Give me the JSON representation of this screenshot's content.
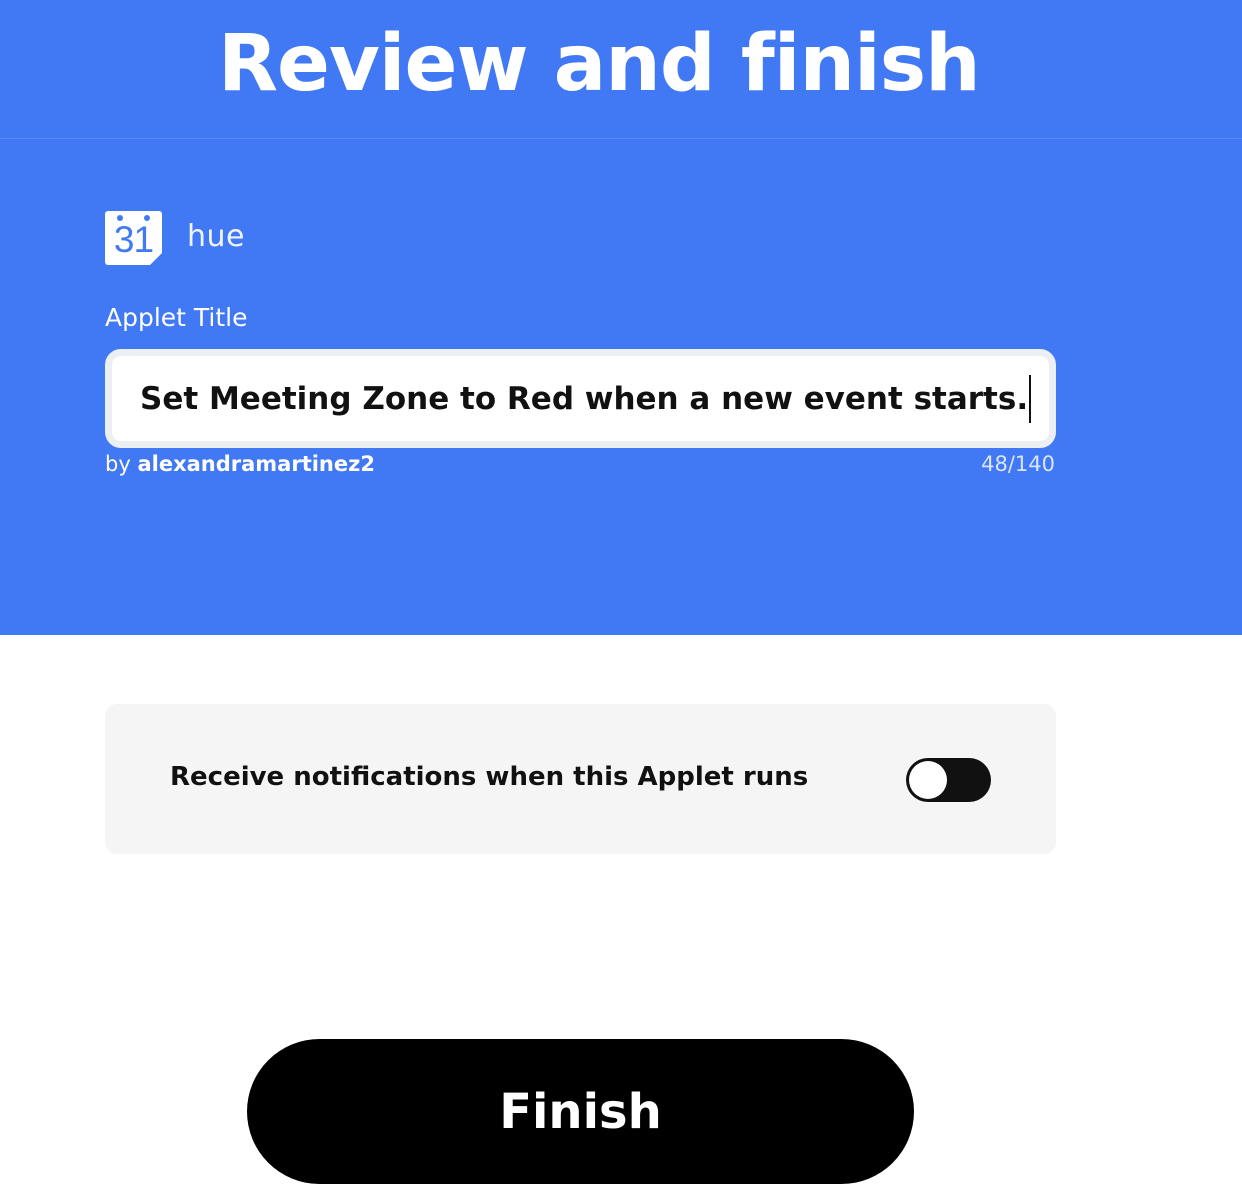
{
  "header": {
    "title": "Review and finish"
  },
  "services": {
    "trigger_icon": "google-calendar-icon",
    "trigger_icon_text": "31",
    "action_icon": "hue-logo",
    "action_logo_text": "hue"
  },
  "applet_title": {
    "label": "Applet Title",
    "value": "Set Meeting Zone to Red when a new event starts.",
    "author_prefix": "by",
    "author": "alexandramartinez2",
    "char_count": "48/140"
  },
  "notifications": {
    "label": "Receive notifications when this Applet runs",
    "enabled": false
  },
  "finish_button": {
    "label": "Finish"
  },
  "colors": {
    "brand_blue": "#4178f4",
    "button_black": "#000000",
    "card_gray": "#f5f5f5"
  }
}
